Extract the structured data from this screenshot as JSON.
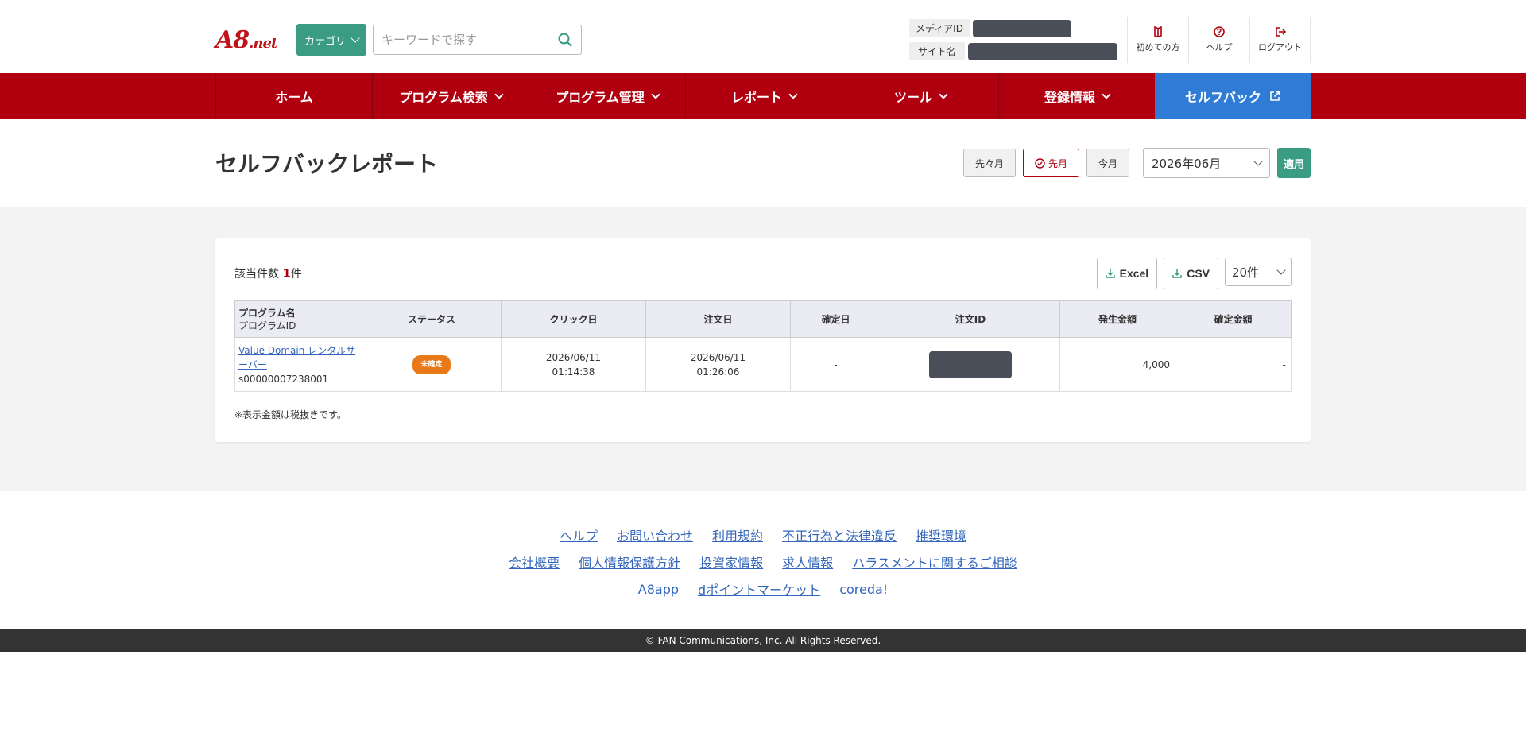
{
  "header": {
    "logo_main": "A8",
    "logo_sub": ".net",
    "category_label": "カテゴリ",
    "search_placeholder": "キーワードで探す",
    "media_id_label": "メディアID",
    "site_name_label": "サイト名",
    "links": [
      {
        "label": "初めての方",
        "icon": "book-icon"
      },
      {
        "label": "ヘルプ",
        "icon": "help-icon"
      },
      {
        "label": "ログアウト",
        "icon": "logout-icon"
      }
    ]
  },
  "nav": {
    "items": [
      {
        "label": "ホーム"
      },
      {
        "label": "プログラム検索"
      },
      {
        "label": "プログラム管理"
      },
      {
        "label": "レポート"
      },
      {
        "label": "ツール"
      },
      {
        "label": "登録情報"
      },
      {
        "label": "セルフバック"
      }
    ]
  },
  "titlebar": {
    "title": "セルフバックレポート",
    "btn_prev2": "先々月",
    "btn_prev": "先月",
    "btn_current": "今月",
    "month_value": "2026年06月",
    "apply_label": "適用"
  },
  "report": {
    "count_label": "該当件数",
    "count_value": "1",
    "count_unit": "件",
    "excel_label": "Excel",
    "csv_label": "CSV",
    "per_page": "20件",
    "columns": {
      "program": "プログラム名",
      "program_id": "プログラムID",
      "status": "ステータス",
      "click_date": "クリック日",
      "order_date": "注文日",
      "confirm_date": "確定日",
      "order_id": "注文ID",
      "amount": "発生金額",
      "confirm_amount": "確定金額"
    },
    "rows": [
      {
        "program_name": "Value Domain レンタルサーバー",
        "program_id": "s00000007238001",
        "status": "未確定",
        "click_date": "2026/06/11",
        "click_time": "01:14:38",
        "order_date": "2026/06/11",
        "order_time": "01:26:06",
        "confirm_date": "-",
        "amount": "4,000",
        "confirm_amount": "-"
      }
    ],
    "note": "※表示金額は税抜きです。"
  },
  "footer": {
    "row1": [
      "ヘルプ",
      "お問い合わせ",
      "利用規約",
      "不正行為と法律違反",
      "推奨環境"
    ],
    "row2": [
      "会社概要",
      "個人情報保護方針",
      "投資家情報",
      "求人情報",
      "ハラスメントに関するご相談"
    ],
    "row3": [
      "A8app",
      "dポイントマーケット",
      "coreda!"
    ],
    "copyright": "© FAN Communications, Inc. All Rights Reserved."
  },
  "colors": {
    "brand_red": "#b00010",
    "accent_green": "#3a9c82",
    "selfback_blue": "#2f7bd6",
    "status_orange": "#e87818"
  }
}
